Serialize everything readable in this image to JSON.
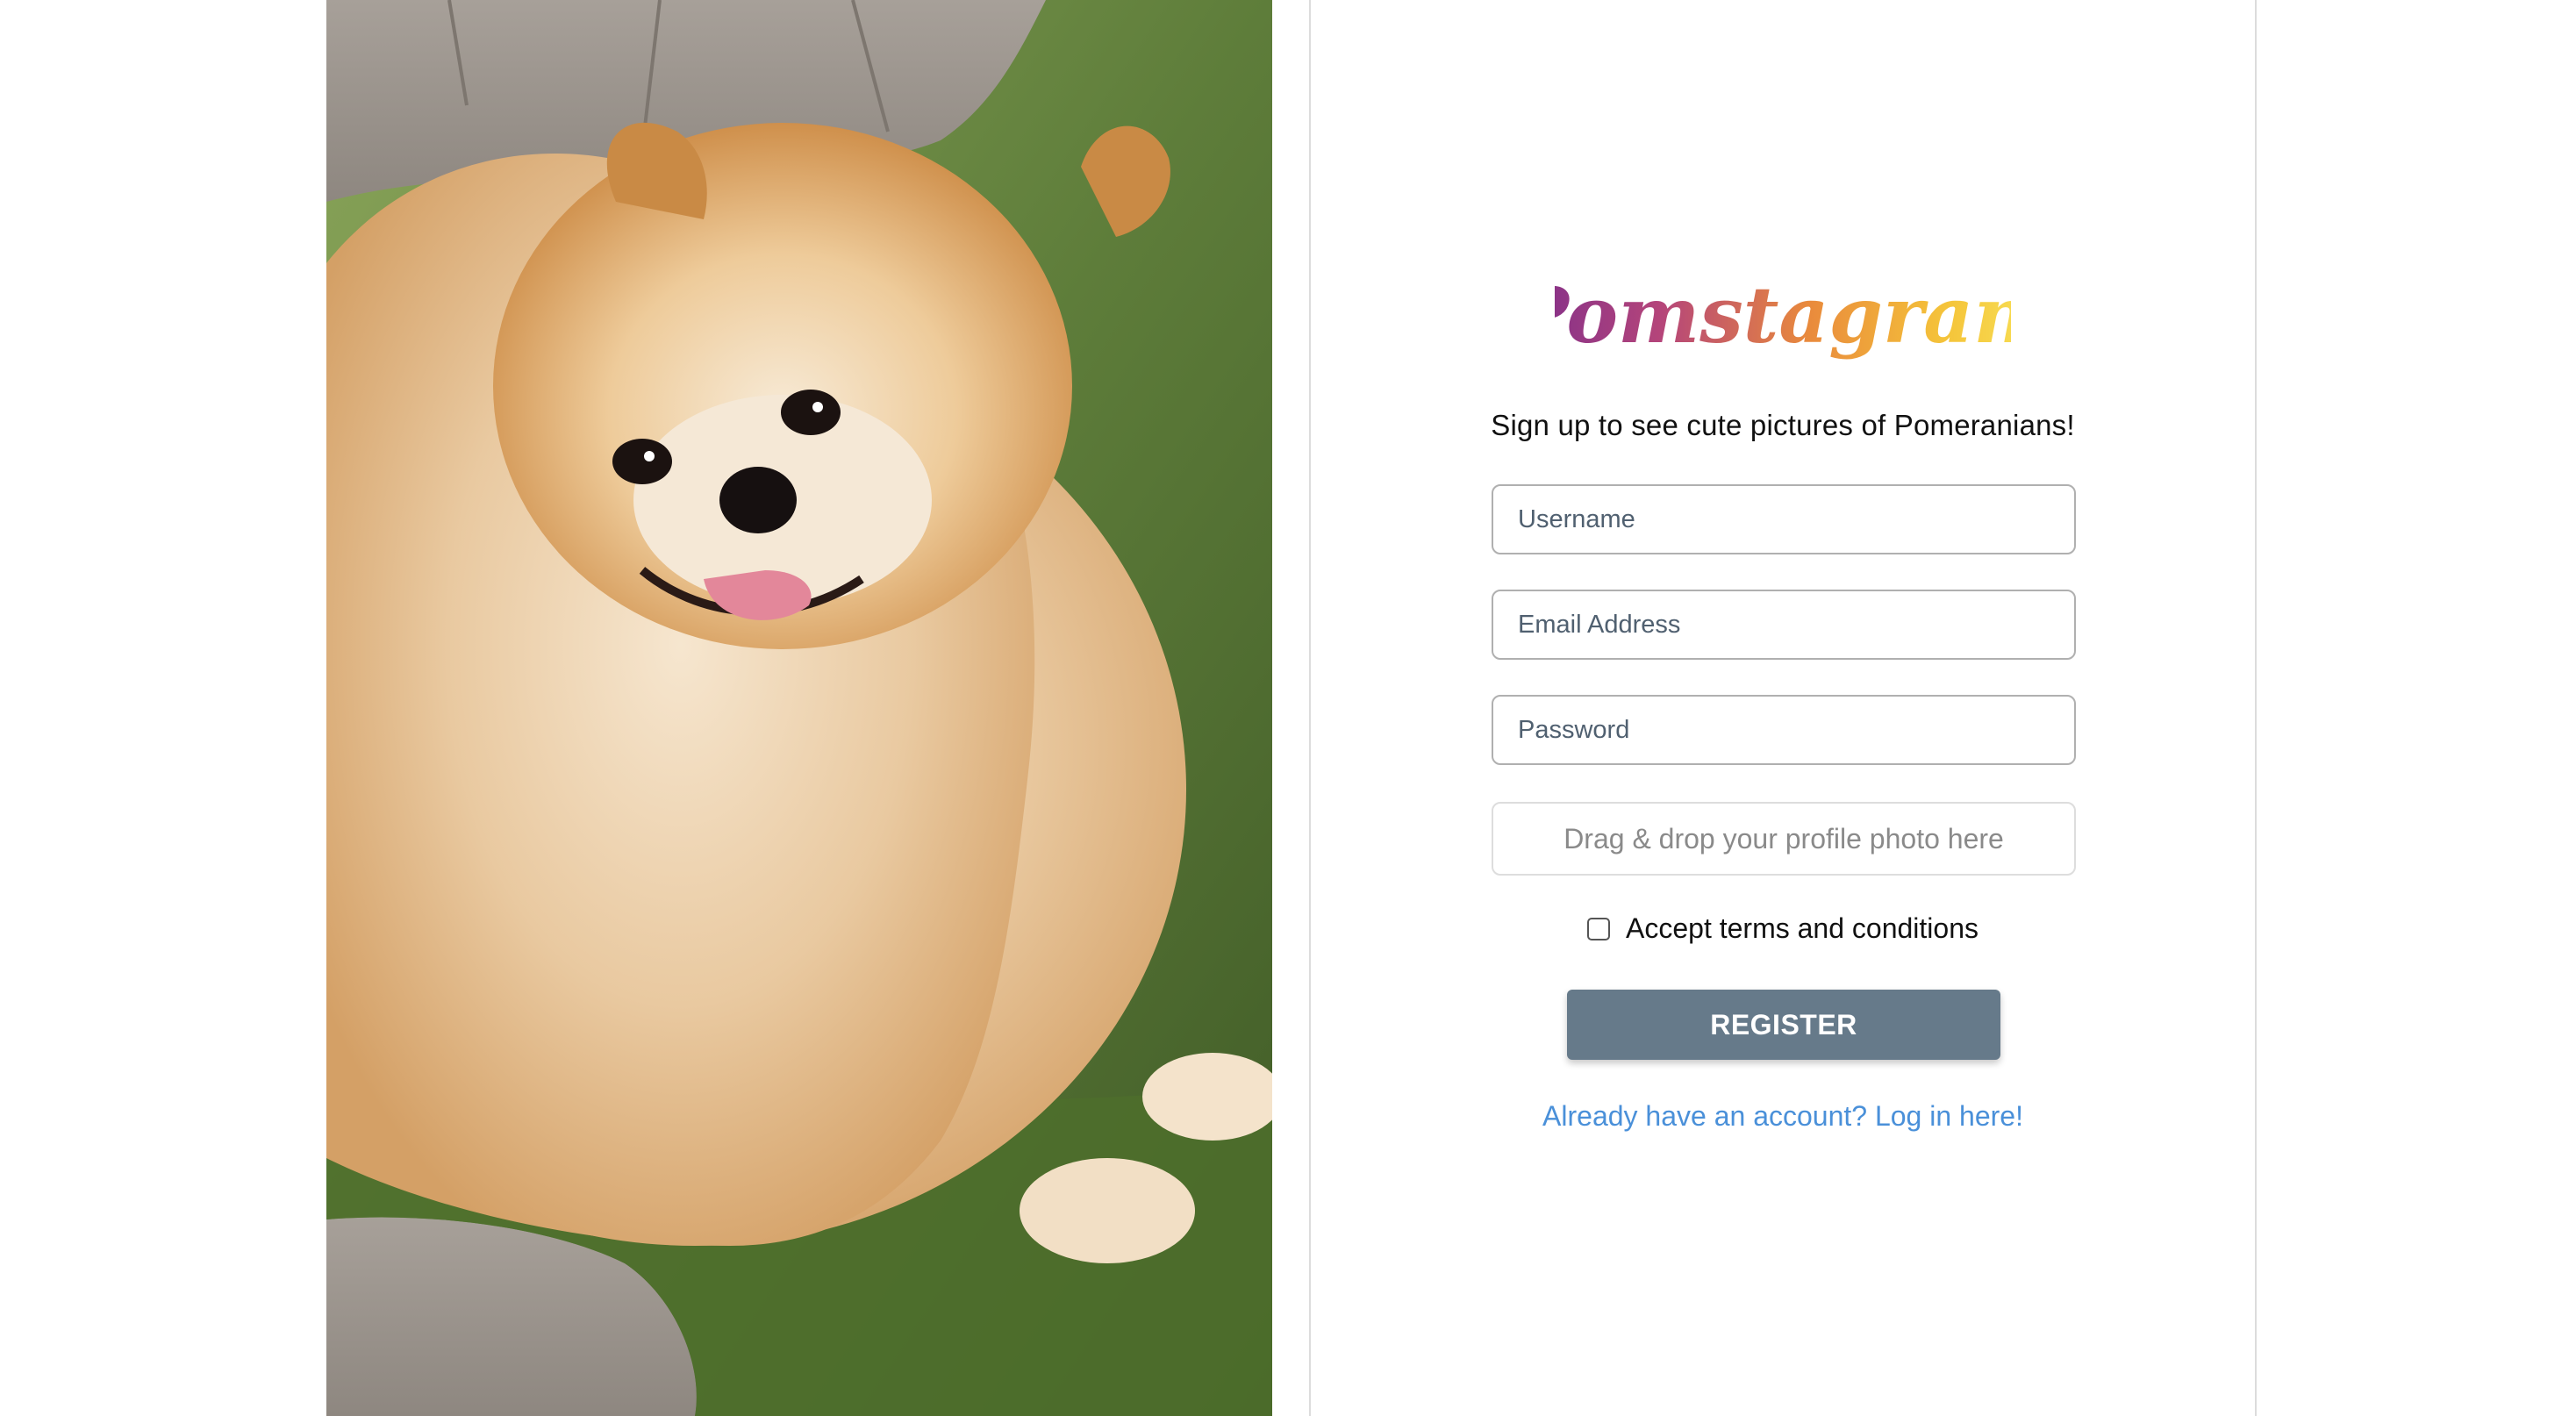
{
  "brand": {
    "logo_text": "Pomstagram",
    "gradient": [
      "#7a2c8c",
      "#b5457a",
      "#e98a3c",
      "#f5c43a",
      "#f8e65c"
    ]
  },
  "photo": {
    "alt": "Pomeranian dog"
  },
  "form": {
    "tagline": "Sign up to see cute pictures of Pomeranians!",
    "username_placeholder": "Username",
    "email_placeholder": "Email Address",
    "password_placeholder": "Password",
    "dropzone_text": "Drag & drop your profile photo here",
    "terms_label": "Accept terms and conditions",
    "terms_checked": false,
    "register_label": "REGISTER",
    "login_link": "Already have an account? Log in here!"
  },
  "colors": {
    "button": "#667a8a",
    "link": "#4a90d9",
    "input_text": "#506070"
  }
}
